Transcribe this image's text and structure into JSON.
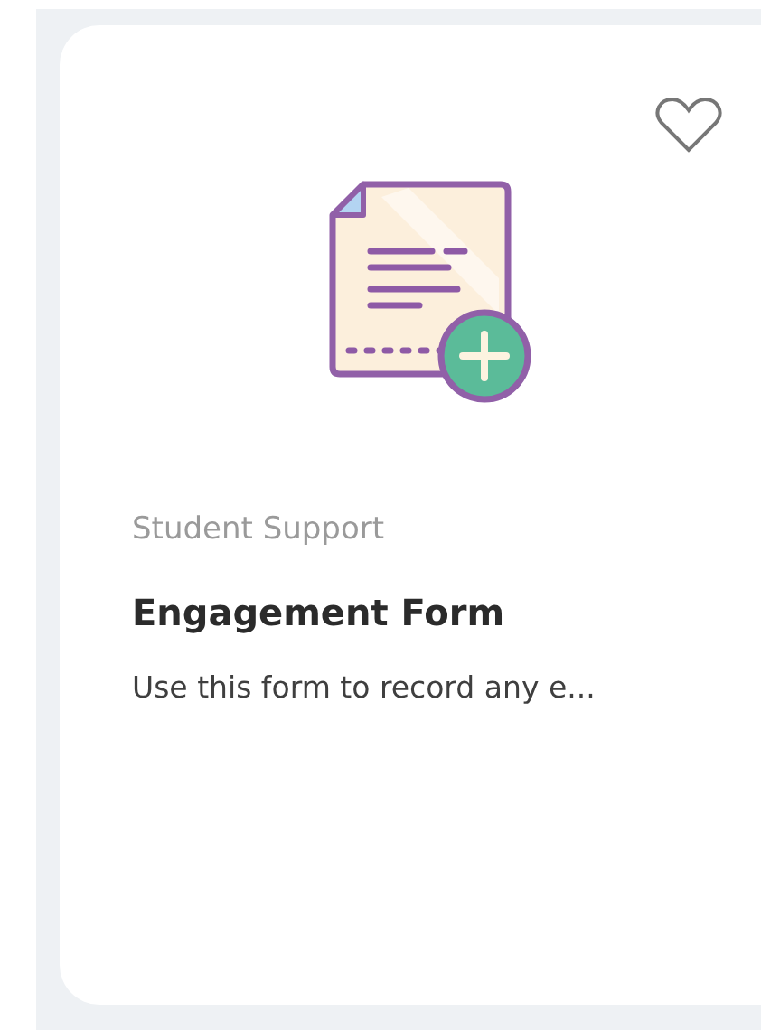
{
  "card": {
    "favorited": false,
    "category": "Student Support",
    "title": "Engagement Form",
    "description": "Use this form to record any e..."
  }
}
